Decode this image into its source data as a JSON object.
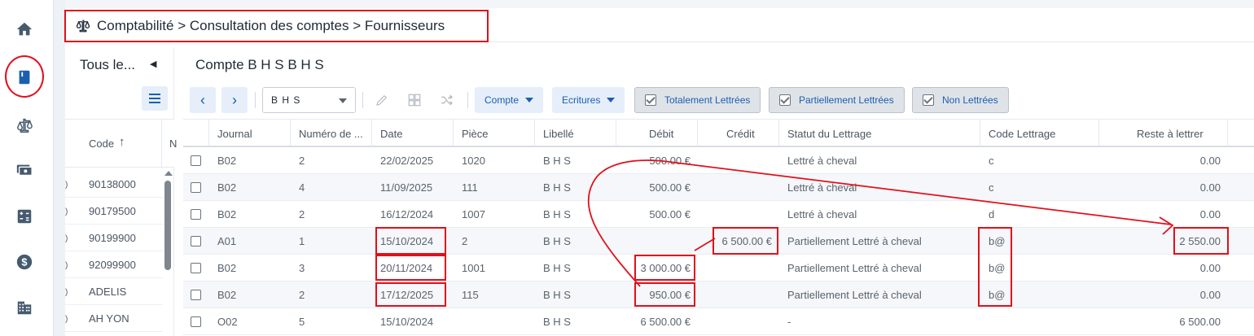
{
  "breadcrumb": "Comptabilité > Consultation des comptes > Fournisseurs",
  "accounts_panel": {
    "title": "Tous le...",
    "column_code": "Code",
    "column_next": "N",
    "codes": [
      "90138000",
      "90179500",
      "90199900",
      "92099900",
      "ADELIS",
      "AH YON"
    ]
  },
  "main": {
    "title": "Compte B H S B H S",
    "account_select": "B H S",
    "dropdowns": [
      "Compte",
      "Ecritures"
    ],
    "filters": [
      "Totalement Lettrées",
      "Partiellement Lettrées",
      "Non Lettrées"
    ]
  },
  "table": {
    "columns": [
      "Journal",
      "Numéro de ...",
      "Date",
      "Pièce",
      "Libellé",
      "Débit",
      "Crédit",
      "Statut du Lettrage",
      "Code Lettrage",
      "Reste à lettrer"
    ],
    "rows": [
      {
        "journal": "B02",
        "numero": "2",
        "date": "22/02/2025",
        "piece": "1020",
        "libelle": "B H S",
        "debit": "500.00 €",
        "credit": "",
        "statut": "Lettré à cheval",
        "code": "c",
        "reste": "0.00"
      },
      {
        "journal": "B02",
        "numero": "4",
        "date": "11/09/2025",
        "piece": "111",
        "libelle": "B H S",
        "debit": "500.00 €",
        "credit": "",
        "statut": "Lettré à cheval",
        "code": "c",
        "reste": "0.00"
      },
      {
        "journal": "B02",
        "numero": "2",
        "date": "16/12/2024",
        "piece": "1007",
        "libelle": "B H S",
        "debit": "500.00 €",
        "credit": "",
        "statut": "Lettré à cheval",
        "code": "d",
        "reste": "0.00"
      },
      {
        "journal": "A01",
        "numero": "1",
        "date": "15/10/2024",
        "piece": "2",
        "libelle": "B H S",
        "debit": "",
        "credit": "6 500.00 €",
        "statut": "Partiellement Lettré à cheval",
        "code": "b@",
        "reste": "2 550.00"
      },
      {
        "journal": "B02",
        "numero": "3",
        "date": "20/11/2024",
        "piece": "1001",
        "libelle": "B H S",
        "debit": "3 000.00 €",
        "credit": "",
        "statut": "Partiellement Lettré à cheval",
        "code": "b@",
        "reste": "0.00"
      },
      {
        "journal": "B02",
        "numero": "2",
        "date": "17/12/2025",
        "piece": "115",
        "libelle": "B H S",
        "debit": "950.00 €",
        "credit": "",
        "statut": "Partiellement Lettré à cheval",
        "code": "b@",
        "reste": "0.00"
      },
      {
        "journal": "O02",
        "numero": "5",
        "date": "15/10/2024",
        "piece": "",
        "libelle": "B H S",
        "debit": "6 500.00 €",
        "credit": "",
        "statut": "-",
        "code": "",
        "reste": "6 500.00"
      }
    ]
  },
  "colors": {
    "accent": "#1b5fb0",
    "annotation": "#e0101b",
    "rail_icon": "#465a6d"
  }
}
